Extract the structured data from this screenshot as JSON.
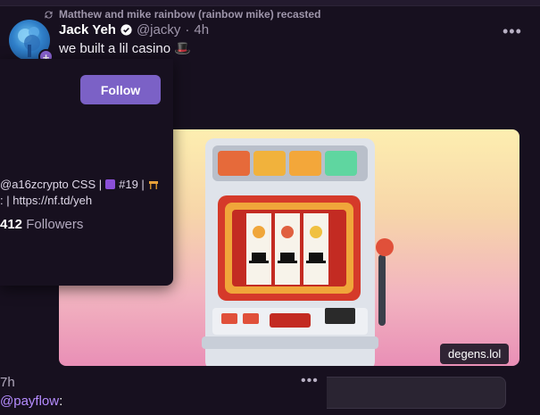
{
  "recast_text": "Matthew and mike rainbow (rainbow mike) recasted",
  "post": {
    "author_name": "Jack Yeh",
    "handle": "@jacky",
    "separator": "·",
    "time": "4h",
    "text": "we built a lil casino 🎩",
    "image_caption": "degens.lol"
  },
  "profile_card": {
    "follow_label": "Follow",
    "bio_line1_a": "@a16zcrypto CSS |",
    "bio_line1_b": "#19 |",
    "bio_line2": ": | https://nf.td/yeh",
    "followers_count": "412",
    "followers_label": "Followers"
  },
  "next_post": {
    "time": "7h",
    "mention": "@payflow",
    "after_mention": ":"
  },
  "colors": {
    "accent": "#7b61c6",
    "mention": "#b58cff",
    "background": "#17101f"
  },
  "icons": [
    "recast-icon",
    "verified-badge-icon",
    "more-icon",
    "follow-button",
    "slot-machine-image"
  ]
}
